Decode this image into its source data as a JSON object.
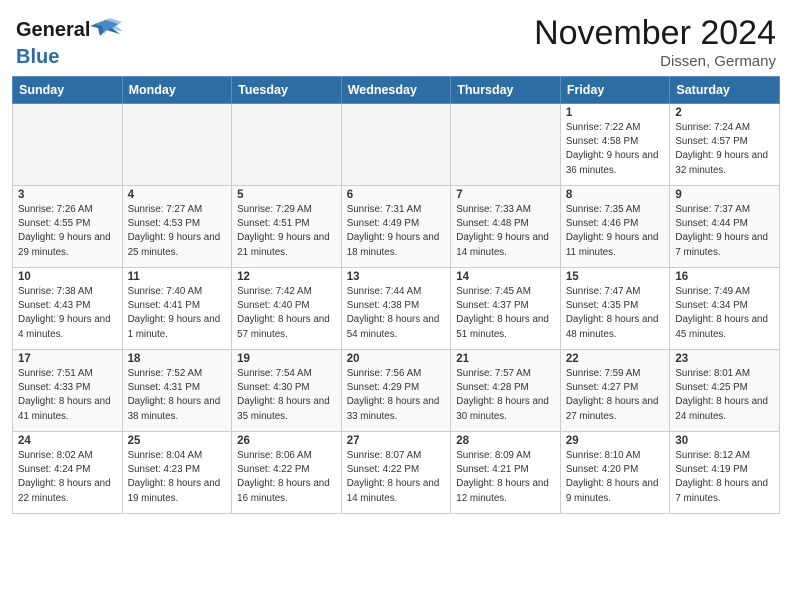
{
  "header": {
    "logo_general": "General",
    "logo_blue": "Blue",
    "month_title": "November 2024",
    "location": "Dissen, Germany"
  },
  "days_of_week": [
    "Sunday",
    "Monday",
    "Tuesday",
    "Wednesday",
    "Thursday",
    "Friday",
    "Saturday"
  ],
  "weeks": [
    [
      {
        "day": "",
        "empty": true
      },
      {
        "day": "",
        "empty": true
      },
      {
        "day": "",
        "empty": true
      },
      {
        "day": "",
        "empty": true
      },
      {
        "day": "",
        "empty": true
      },
      {
        "day": "1",
        "sunrise": "Sunrise: 7:22 AM",
        "sunset": "Sunset: 4:58 PM",
        "daylight": "Daylight: 9 hours and 36 minutes."
      },
      {
        "day": "2",
        "sunrise": "Sunrise: 7:24 AM",
        "sunset": "Sunset: 4:57 PM",
        "daylight": "Daylight: 9 hours and 32 minutes."
      }
    ],
    [
      {
        "day": "3",
        "sunrise": "Sunrise: 7:26 AM",
        "sunset": "Sunset: 4:55 PM",
        "daylight": "Daylight: 9 hours and 29 minutes."
      },
      {
        "day": "4",
        "sunrise": "Sunrise: 7:27 AM",
        "sunset": "Sunset: 4:53 PM",
        "daylight": "Daylight: 9 hours and 25 minutes."
      },
      {
        "day": "5",
        "sunrise": "Sunrise: 7:29 AM",
        "sunset": "Sunset: 4:51 PM",
        "daylight": "Daylight: 9 hours and 21 minutes."
      },
      {
        "day": "6",
        "sunrise": "Sunrise: 7:31 AM",
        "sunset": "Sunset: 4:49 PM",
        "daylight": "Daylight: 9 hours and 18 minutes."
      },
      {
        "day": "7",
        "sunrise": "Sunrise: 7:33 AM",
        "sunset": "Sunset: 4:48 PM",
        "daylight": "Daylight: 9 hours and 14 minutes."
      },
      {
        "day": "8",
        "sunrise": "Sunrise: 7:35 AM",
        "sunset": "Sunset: 4:46 PM",
        "daylight": "Daylight: 9 hours and 11 minutes."
      },
      {
        "day": "9",
        "sunrise": "Sunrise: 7:37 AM",
        "sunset": "Sunset: 4:44 PM",
        "daylight": "Daylight: 9 hours and 7 minutes."
      }
    ],
    [
      {
        "day": "10",
        "sunrise": "Sunrise: 7:38 AM",
        "sunset": "Sunset: 4:43 PM",
        "daylight": "Daylight: 9 hours and 4 minutes."
      },
      {
        "day": "11",
        "sunrise": "Sunrise: 7:40 AM",
        "sunset": "Sunset: 4:41 PM",
        "daylight": "Daylight: 9 hours and 1 minute."
      },
      {
        "day": "12",
        "sunrise": "Sunrise: 7:42 AM",
        "sunset": "Sunset: 4:40 PM",
        "daylight": "Daylight: 8 hours and 57 minutes."
      },
      {
        "day": "13",
        "sunrise": "Sunrise: 7:44 AM",
        "sunset": "Sunset: 4:38 PM",
        "daylight": "Daylight: 8 hours and 54 minutes."
      },
      {
        "day": "14",
        "sunrise": "Sunrise: 7:45 AM",
        "sunset": "Sunset: 4:37 PM",
        "daylight": "Daylight: 8 hours and 51 minutes."
      },
      {
        "day": "15",
        "sunrise": "Sunrise: 7:47 AM",
        "sunset": "Sunset: 4:35 PM",
        "daylight": "Daylight: 8 hours and 48 minutes."
      },
      {
        "day": "16",
        "sunrise": "Sunrise: 7:49 AM",
        "sunset": "Sunset: 4:34 PM",
        "daylight": "Daylight: 8 hours and 45 minutes."
      }
    ],
    [
      {
        "day": "17",
        "sunrise": "Sunrise: 7:51 AM",
        "sunset": "Sunset: 4:33 PM",
        "daylight": "Daylight: 8 hours and 41 minutes."
      },
      {
        "day": "18",
        "sunrise": "Sunrise: 7:52 AM",
        "sunset": "Sunset: 4:31 PM",
        "daylight": "Daylight: 8 hours and 38 minutes."
      },
      {
        "day": "19",
        "sunrise": "Sunrise: 7:54 AM",
        "sunset": "Sunset: 4:30 PM",
        "daylight": "Daylight: 8 hours and 35 minutes."
      },
      {
        "day": "20",
        "sunrise": "Sunrise: 7:56 AM",
        "sunset": "Sunset: 4:29 PM",
        "daylight": "Daylight: 8 hours and 33 minutes."
      },
      {
        "day": "21",
        "sunrise": "Sunrise: 7:57 AM",
        "sunset": "Sunset: 4:28 PM",
        "daylight": "Daylight: 8 hours and 30 minutes."
      },
      {
        "day": "22",
        "sunrise": "Sunrise: 7:59 AM",
        "sunset": "Sunset: 4:27 PM",
        "daylight": "Daylight: 8 hours and 27 minutes."
      },
      {
        "day": "23",
        "sunrise": "Sunrise: 8:01 AM",
        "sunset": "Sunset: 4:25 PM",
        "daylight": "Daylight: 8 hours and 24 minutes."
      }
    ],
    [
      {
        "day": "24",
        "sunrise": "Sunrise: 8:02 AM",
        "sunset": "Sunset: 4:24 PM",
        "daylight": "Daylight: 8 hours and 22 minutes."
      },
      {
        "day": "25",
        "sunrise": "Sunrise: 8:04 AM",
        "sunset": "Sunset: 4:23 PM",
        "daylight": "Daylight: 8 hours and 19 minutes."
      },
      {
        "day": "26",
        "sunrise": "Sunrise: 8:06 AM",
        "sunset": "Sunset: 4:22 PM",
        "daylight": "Daylight: 8 hours and 16 minutes."
      },
      {
        "day": "27",
        "sunrise": "Sunrise: 8:07 AM",
        "sunset": "Sunset: 4:22 PM",
        "daylight": "Daylight: 8 hours and 14 minutes."
      },
      {
        "day": "28",
        "sunrise": "Sunrise: 8:09 AM",
        "sunset": "Sunset: 4:21 PM",
        "daylight": "Daylight: 8 hours and 12 minutes."
      },
      {
        "day": "29",
        "sunrise": "Sunrise: 8:10 AM",
        "sunset": "Sunset: 4:20 PM",
        "daylight": "Daylight: 8 hours and 9 minutes."
      },
      {
        "day": "30",
        "sunrise": "Sunrise: 8:12 AM",
        "sunset": "Sunset: 4:19 PM",
        "daylight": "Daylight: 8 hours and 7 minutes."
      }
    ]
  ]
}
